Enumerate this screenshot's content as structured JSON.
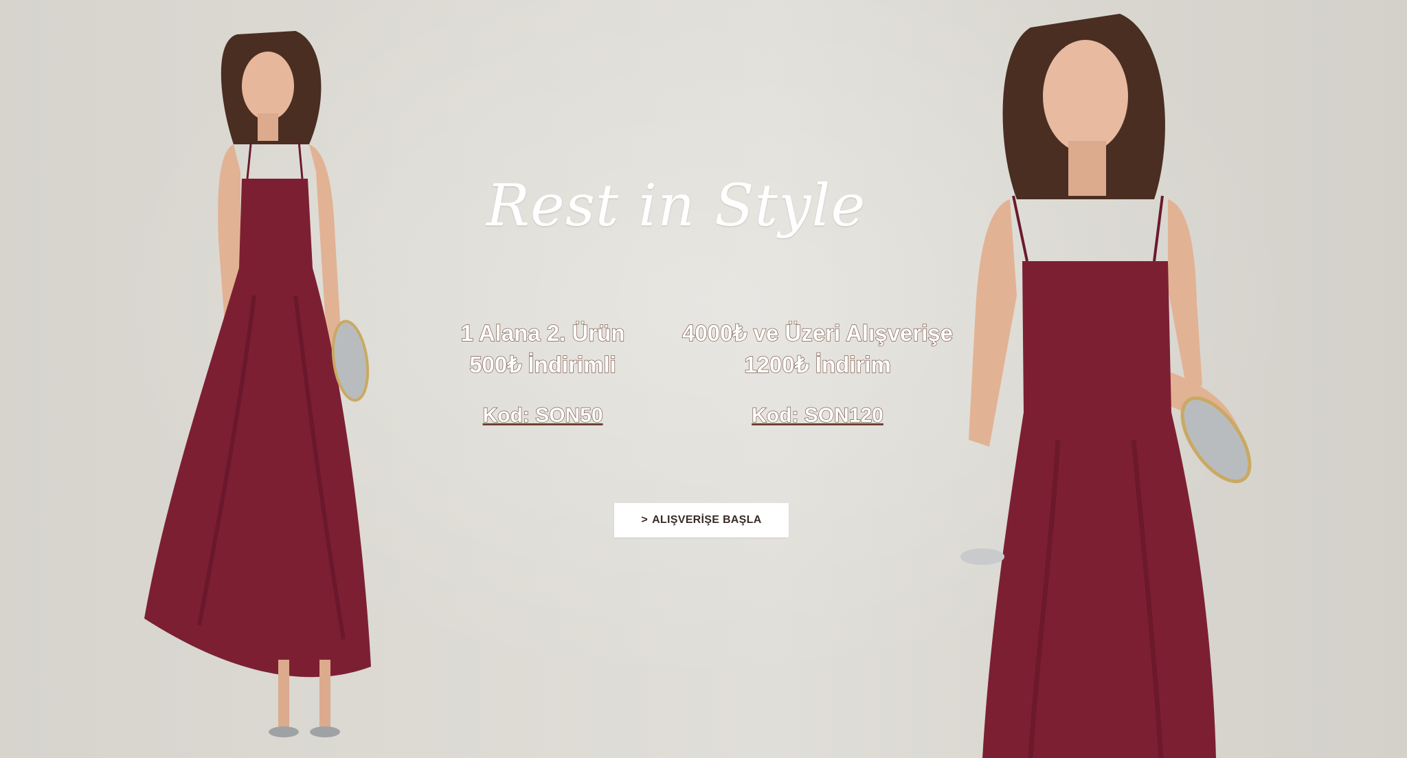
{
  "banner": {
    "headline": "Rest in Style",
    "promos": [
      {
        "line1": "1 Alana 2. Ürün",
        "line2": "500₺ İndirimli",
        "code": "Kod: SON50"
      },
      {
        "line1": "4000₺ ve Üzeri Alışverişe",
        "line2": "1200₺ İndirim",
        "code": "Kod: SON120"
      }
    ],
    "cta": {
      "chevron": ">",
      "label": "ALIŞVERİŞE BAŞLA"
    }
  },
  "images": [
    {
      "name": "model-left-photo",
      "alt": "model-in-burgundy-dress-full-length"
    },
    {
      "name": "model-right-photo",
      "alt": "model-in-burgundy-dress-closeup"
    }
  ],
  "colors": {
    "dress": "#7d1f33",
    "dress_shadow": "#5e1426",
    "skin": "#e6b79b",
    "hair": "#4a2e22",
    "text_stroke": "#6b4232",
    "background": "#dcdad3"
  }
}
